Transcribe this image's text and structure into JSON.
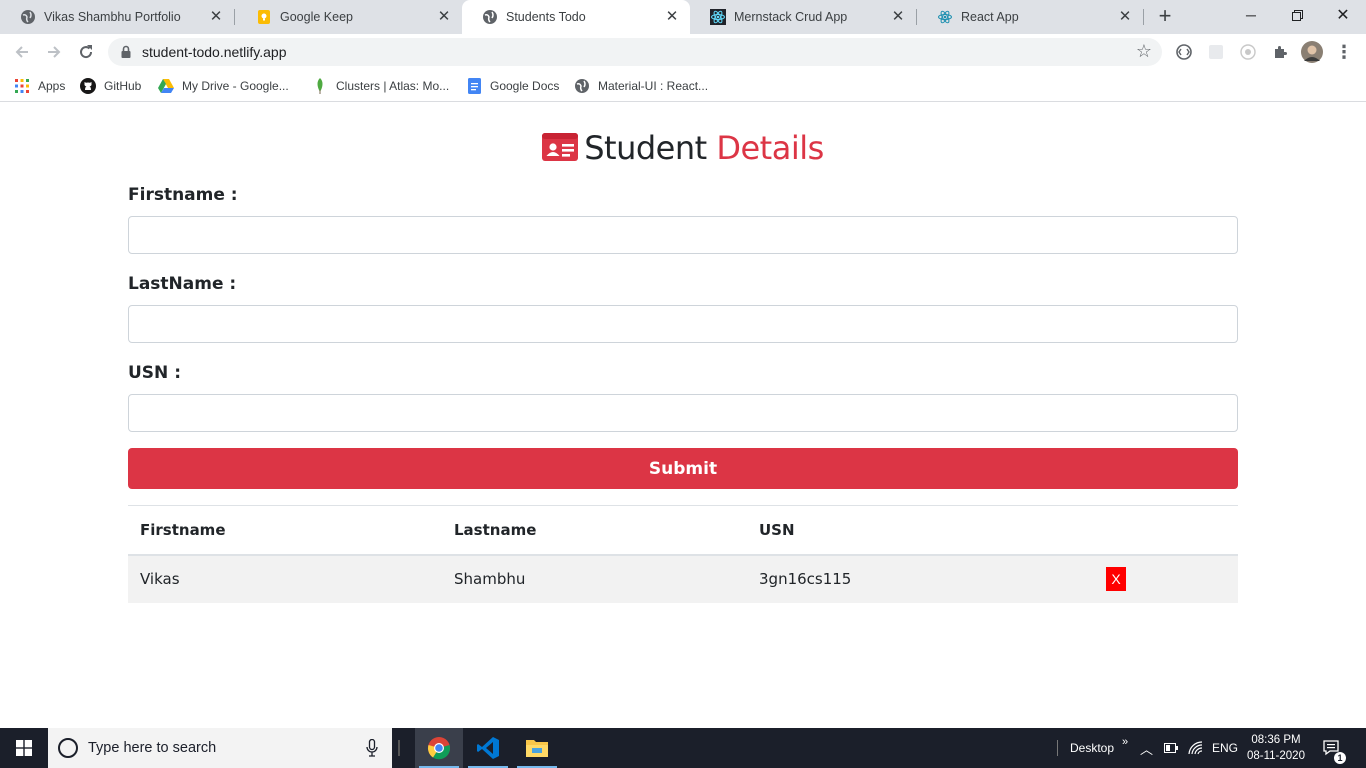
{
  "browser": {
    "tabs": [
      {
        "title": "Vikas Shambhu Portfolio",
        "icon": "globe-icon",
        "active": false
      },
      {
        "title": "Google Keep",
        "icon": "google-keep-icon",
        "active": false
      },
      {
        "title": "Students Todo",
        "icon": "globe-icon",
        "active": true
      },
      {
        "title": "Mernstack Crud App",
        "icon": "react-icon",
        "active": false
      },
      {
        "title": "React App",
        "icon": "react-icon",
        "active": false
      }
    ],
    "url": "student-todo.netlify.app",
    "bookmarks": [
      {
        "label": "Apps",
        "icon": "apps-grid-icon"
      },
      {
        "label": "GitHub",
        "icon": "github-icon"
      },
      {
        "label": "My Drive - Google...",
        "icon": "google-drive-icon"
      },
      {
        "label": "Clusters | Atlas: Mo...",
        "icon": "mongodb-leaf-icon"
      },
      {
        "label": "Google Docs",
        "icon": "google-docs-icon"
      },
      {
        "label": "Material-UI : React...",
        "icon": "globe-icon"
      }
    ]
  },
  "page": {
    "heading_part1": "Student",
    "heading_part2": "Details",
    "accent_color": "#dc3545",
    "form": {
      "firstname_label": "Firstname :",
      "lastname_label": "LastName :",
      "usn_label": "USN :",
      "firstname_value": "",
      "lastname_value": "",
      "usn_value": "",
      "submit_label": "Submit"
    },
    "table": {
      "headers": [
        "Firstname",
        "Lastname",
        "USN"
      ],
      "rows": [
        {
          "firstname": "Vikas",
          "lastname": "Shambhu",
          "usn": "3gn16cs115",
          "delete_label": "X"
        }
      ]
    }
  },
  "taskbar": {
    "search_placeholder": "Type here to search",
    "desktop_label": "Desktop",
    "language": "ENG",
    "time": "08:36 PM",
    "date": "08-11-2020",
    "notification_count": "1"
  }
}
